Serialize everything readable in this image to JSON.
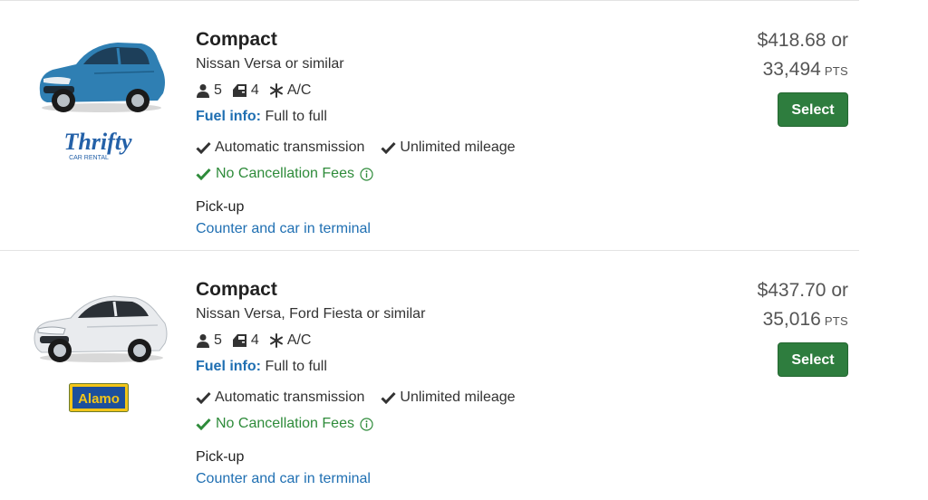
{
  "listings": [
    {
      "category": "Compact",
      "model": "Nissan Versa or similar",
      "passengers": "5",
      "doors": "4",
      "ac": "A/C",
      "fuel_label": "Fuel info:",
      "fuel_value": "Full to full",
      "feature_1": "Automatic transmission",
      "feature_2": "Unlimited mileage",
      "cancellation": "No Cancellation Fees",
      "pickup_label": "Pick-up",
      "pickup_location": "Counter and car in terminal",
      "price": "$418.68 or",
      "points": "33,494",
      "points_unit": "PTS",
      "select_label": "Select",
      "vendor": "Thrifty",
      "vendor_sub": "CAR RENTAL",
      "car_color": "#2f7fb3"
    },
    {
      "category": "Compact",
      "model": "Nissan Versa, Ford Fiesta or similar",
      "passengers": "5",
      "doors": "4",
      "ac": "A/C",
      "fuel_label": "Fuel info:",
      "fuel_value": "Full to full",
      "feature_1": "Automatic transmission",
      "feature_2": "Unlimited mileage",
      "cancellation": "No Cancellation Fees",
      "pickup_label": "Pick-up",
      "pickup_location": "Counter and car in terminal",
      "price": "$437.70 or",
      "points": "35,016",
      "points_unit": "PTS",
      "select_label": "Select",
      "vendor": "Alamo",
      "car_color": "#e9ebee"
    }
  ],
  "colors": {
    "link": "#1f6fb2",
    "success": "#2e8b3a",
    "button": "#2e7d3e"
  }
}
